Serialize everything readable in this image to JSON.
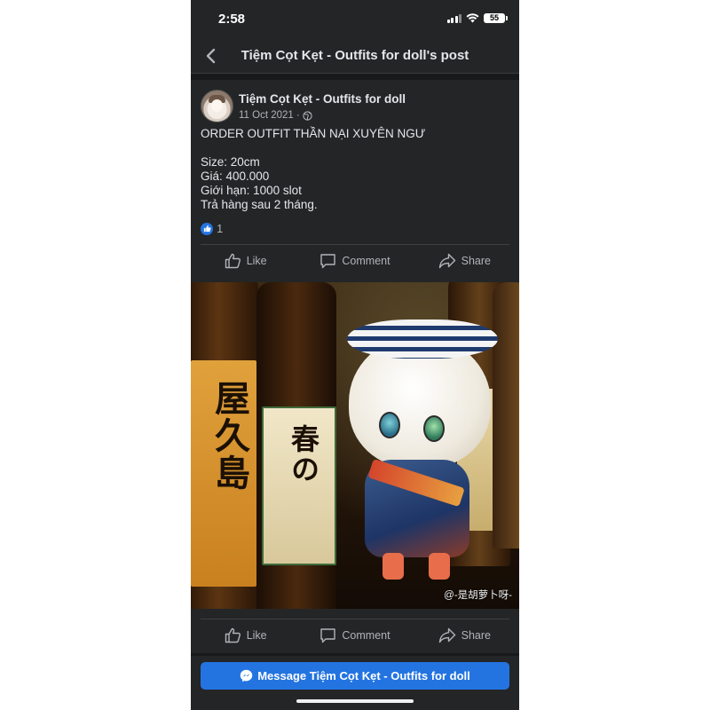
{
  "status_bar": {
    "time": "2:58",
    "battery": "55"
  },
  "header": {
    "title": "Tiệm Cọt Kẹt - Outfits for doll's post"
  },
  "post": {
    "author": "Tiệm Cọt Kẹt - Outfits for doll",
    "date": "11 Oct 2021",
    "separator": "·",
    "privacy_icon": "globe-icon",
    "lines": [
      "ORDER OUTFIT THẦN NẠI XUYÊN NGƯ",
      "",
      "Size: 20cm",
      "Giá: 400.000",
      "Giới hạn: 1000 slot",
      "Trả hàng sau 2 tháng."
    ],
    "reaction_count": "1"
  },
  "actions": {
    "like": "Like",
    "comment": "Comment",
    "share": "Share"
  },
  "photo": {
    "watermark": "@-是胡萝卜呀-"
  },
  "message_button": {
    "label": "Message Tiệm Cọt Kẹt - Outfits for doll"
  },
  "colors": {
    "background": "#242526",
    "accent": "#2374e1",
    "text": "#e4e6eb",
    "muted": "#b0b3b8"
  }
}
